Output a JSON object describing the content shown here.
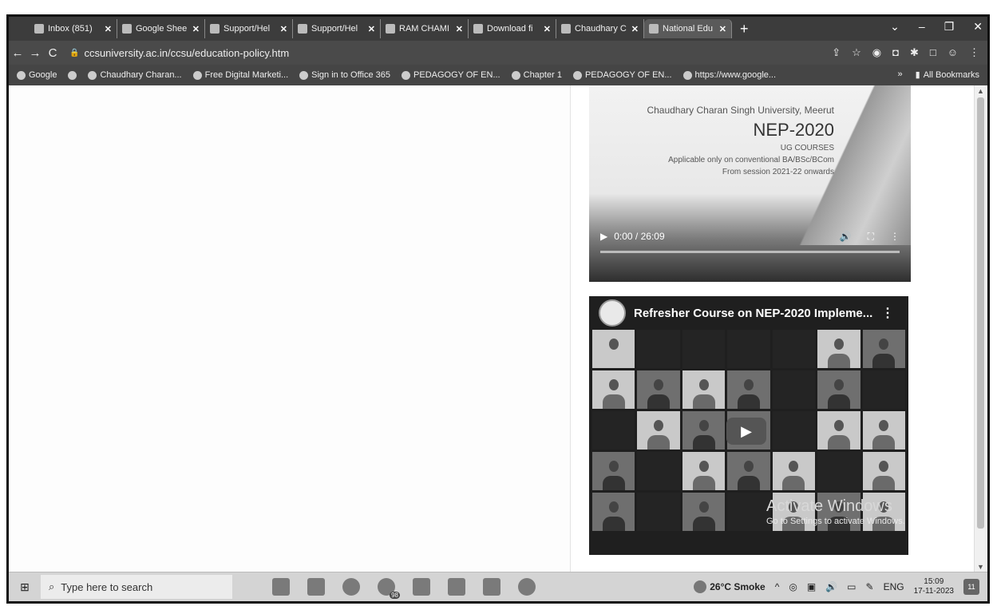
{
  "browser": {
    "tabs": [
      {
        "label": "Inbox (851)",
        "icon": "gmail-icon"
      },
      {
        "label": "Google Shee",
        "icon": "sheets-icon"
      },
      {
        "label": "Support/Hel",
        "icon": "support-icon"
      },
      {
        "label": "Support/Hel",
        "icon": "support-icon"
      },
      {
        "label": "RAM CHAMI",
        "icon": "site-icon"
      },
      {
        "label": "Download fi",
        "icon": "download-icon"
      },
      {
        "label": "Chaudhary C",
        "icon": "site-icon"
      },
      {
        "label": "National Edu",
        "icon": "loading-icon"
      }
    ],
    "new_tab": "+",
    "url": "ccsuniversity.ac.in/ccsu/education-policy.htm",
    "bookmarks": [
      "Google",
      "Chaudhary Charan...",
      "Free Digital Marketi...",
      "Sign in to Office 365",
      "PEDAGOGY OF EN...",
      "Chapter 1",
      "PEDAGOGY OF EN...",
      "https://www.google..."
    ],
    "bookmarks_more": "»",
    "all_bookmarks": "All Bookmarks"
  },
  "video1": {
    "university": "Chaudhary Charan Singh University, Meerut",
    "title": "NEP-2020",
    "subtitle": "UG COURSES",
    "applicable": "Applicable only on conventional BA/BSc/BCom",
    "from": "From session 2021-22 onwards",
    "time": "0:00 / 26:09"
  },
  "video2": {
    "title": "Refresher Course on NEP-2020 Impleme...",
    "watermark": "Activate Windows",
    "watermark_sub": "Go to Settings to activate Windows."
  },
  "taskbar": {
    "search_placeholder": "Type here to search",
    "badge": "98",
    "weather": "26°C Smoke",
    "lang": "ENG",
    "time": "15:09",
    "date": "17-11-2023",
    "notif_count": "11"
  }
}
